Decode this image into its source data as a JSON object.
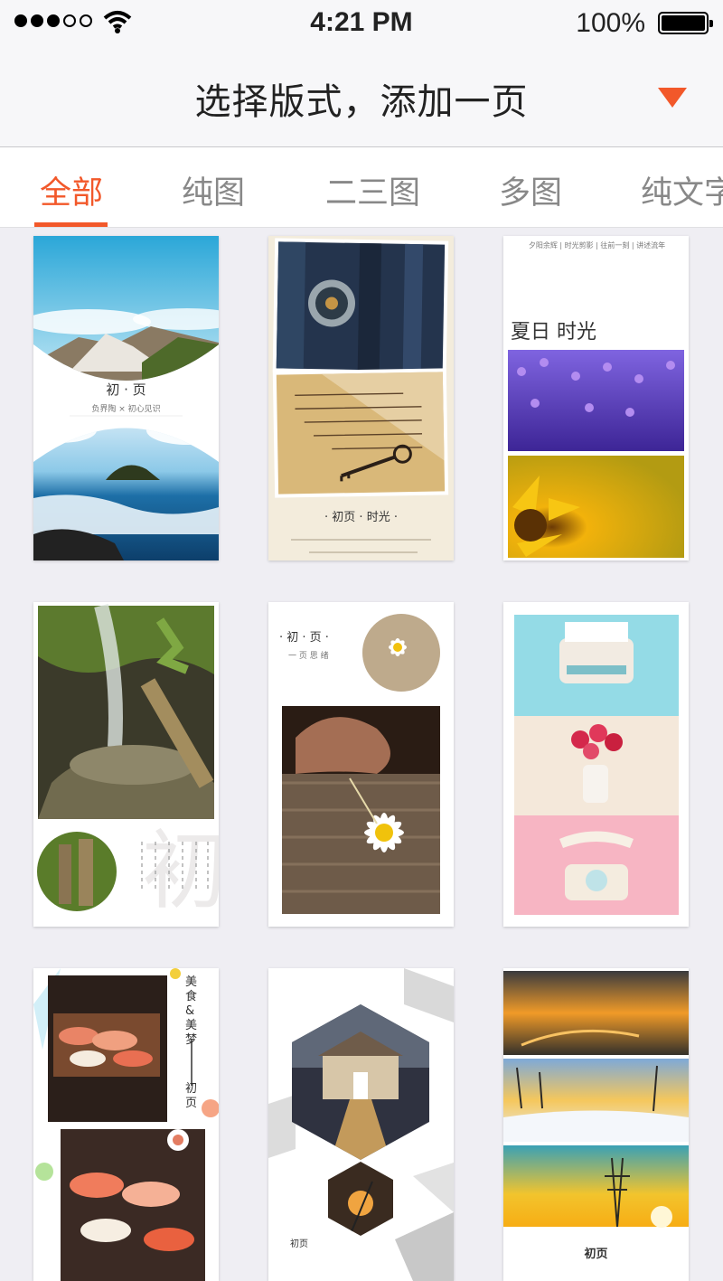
{
  "status_bar": {
    "time": "4:21 PM",
    "battery": "100%"
  },
  "nav": {
    "title": "选择版式，添加一页"
  },
  "tabs": [
    {
      "label": "全部",
      "active": true
    },
    {
      "label": "纯图"
    },
    {
      "label": "二三图"
    },
    {
      "label": "多图"
    },
    {
      "label": "纯文字"
    }
  ],
  "templates": {
    "t1": {
      "title": "初 · 页",
      "subtitle": "负界陶 × 初心见识"
    },
    "t2": {
      "title": "· 初页 · 时光 ·"
    },
    "t3": {
      "header": "夕阳余辉 | 时光剪影 | 往前一刻 | 讲述流年",
      "title": "夏日 时光"
    },
    "t4": {
      "watermark": "初"
    },
    "t5": {
      "title": "· 初 · 页 ·",
      "subtitle": "一 页 思 绪"
    },
    "t7": {
      "side_text": "美食&美梦",
      "side_text2": "初页"
    },
    "t8": {
      "title": "初页"
    },
    "t9": {
      "title": "初页"
    }
  },
  "colors": {
    "accent": "#f2582a"
  }
}
